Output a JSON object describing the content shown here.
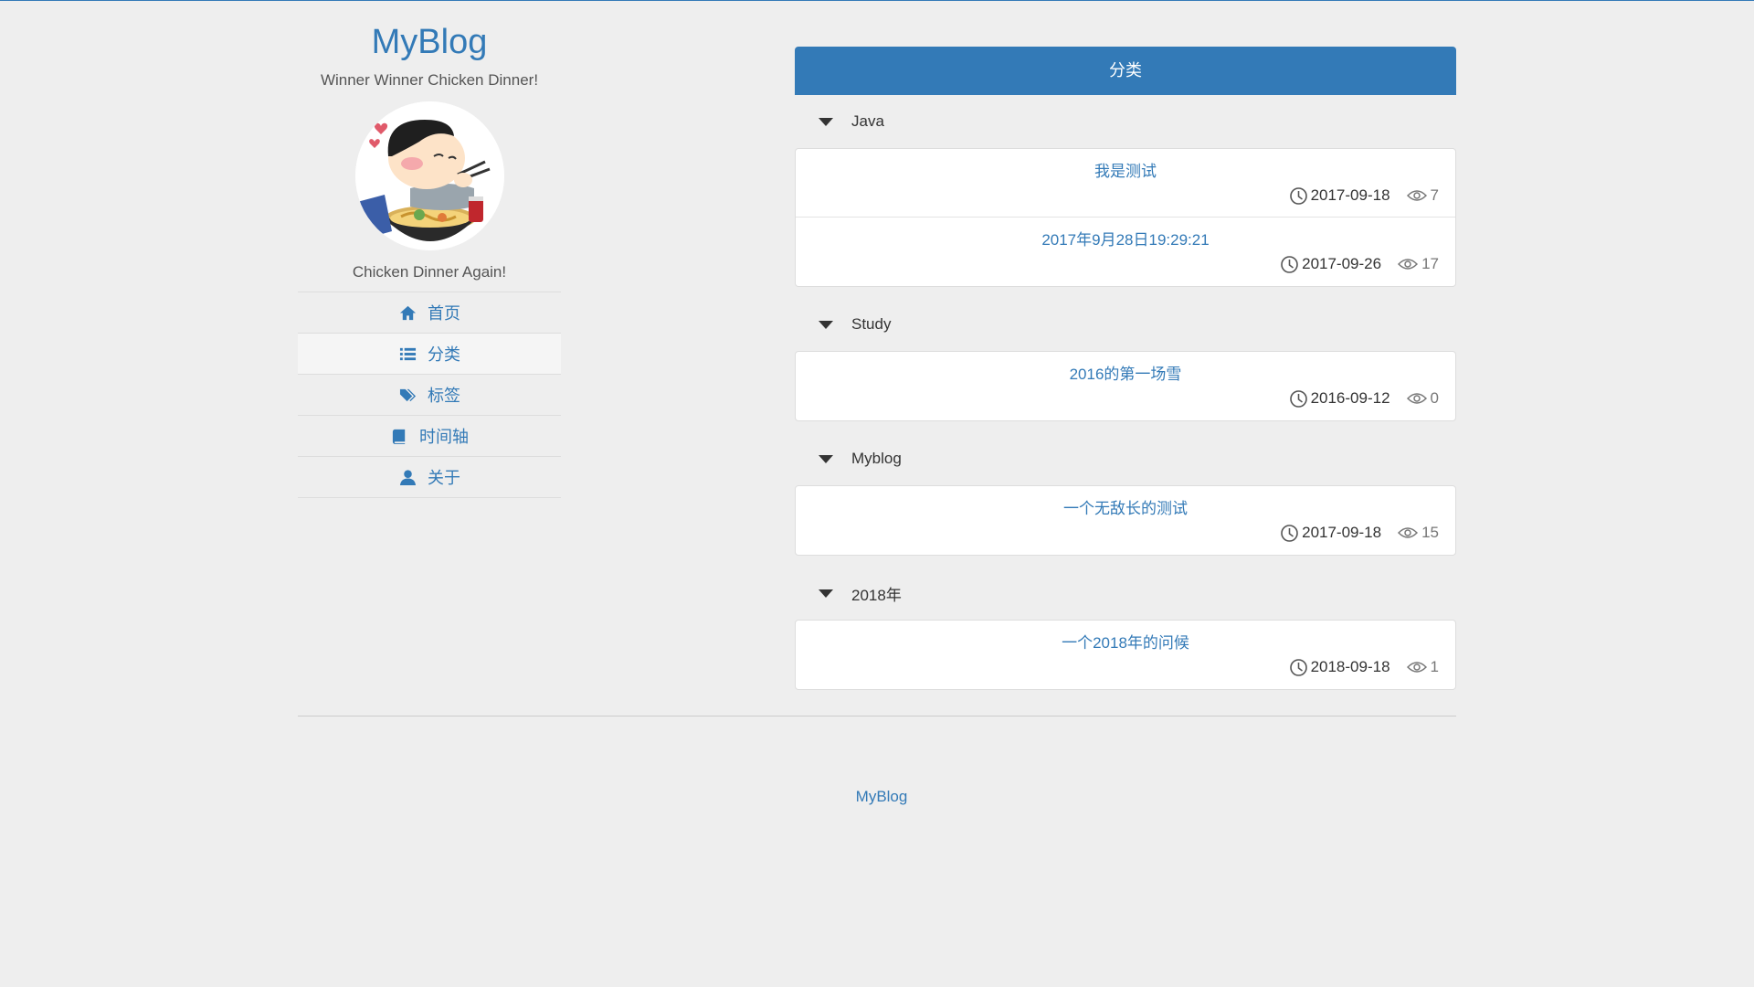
{
  "sidebar": {
    "site_title": "MyBlog",
    "subtitle": "Winner Winner Chicken Dinner!",
    "avatar_caption": "Chicken Dinner Again!",
    "nav": [
      {
        "label": "首页",
        "icon": "home-icon"
      },
      {
        "label": "分类",
        "icon": "list-icon",
        "active": true
      },
      {
        "label": "标签",
        "icon": "tags-icon"
      },
      {
        "label": "时间轴",
        "icon": "book-icon"
      },
      {
        "label": "关于",
        "icon": "user-icon"
      }
    ]
  },
  "main": {
    "panel_title": "分类",
    "categories": [
      {
        "name": "Java",
        "posts": [
          {
            "title": "我是测试",
            "date": "2017-09-18",
            "views": "7"
          },
          {
            "title": "2017年9月28日19:29:21",
            "date": "2017-09-26",
            "views": "17"
          }
        ]
      },
      {
        "name": "Study",
        "posts": [
          {
            "title": "2016的第一场雪",
            "date": "2016-09-12",
            "views": "0"
          }
        ]
      },
      {
        "name": "Myblog",
        "posts": [
          {
            "title": "一个无敌长的测试",
            "date": "2017-09-18",
            "views": "15"
          }
        ]
      },
      {
        "name": "2018年",
        "posts": [
          {
            "title": "一个2018年的问候",
            "date": "2018-09-18",
            "views": "1"
          }
        ]
      }
    ]
  },
  "footer": {
    "link_label": "MyBlog"
  },
  "colors": {
    "accent": "#337ab7",
    "background": "#eeeeee",
    "card": "#ffffff"
  }
}
